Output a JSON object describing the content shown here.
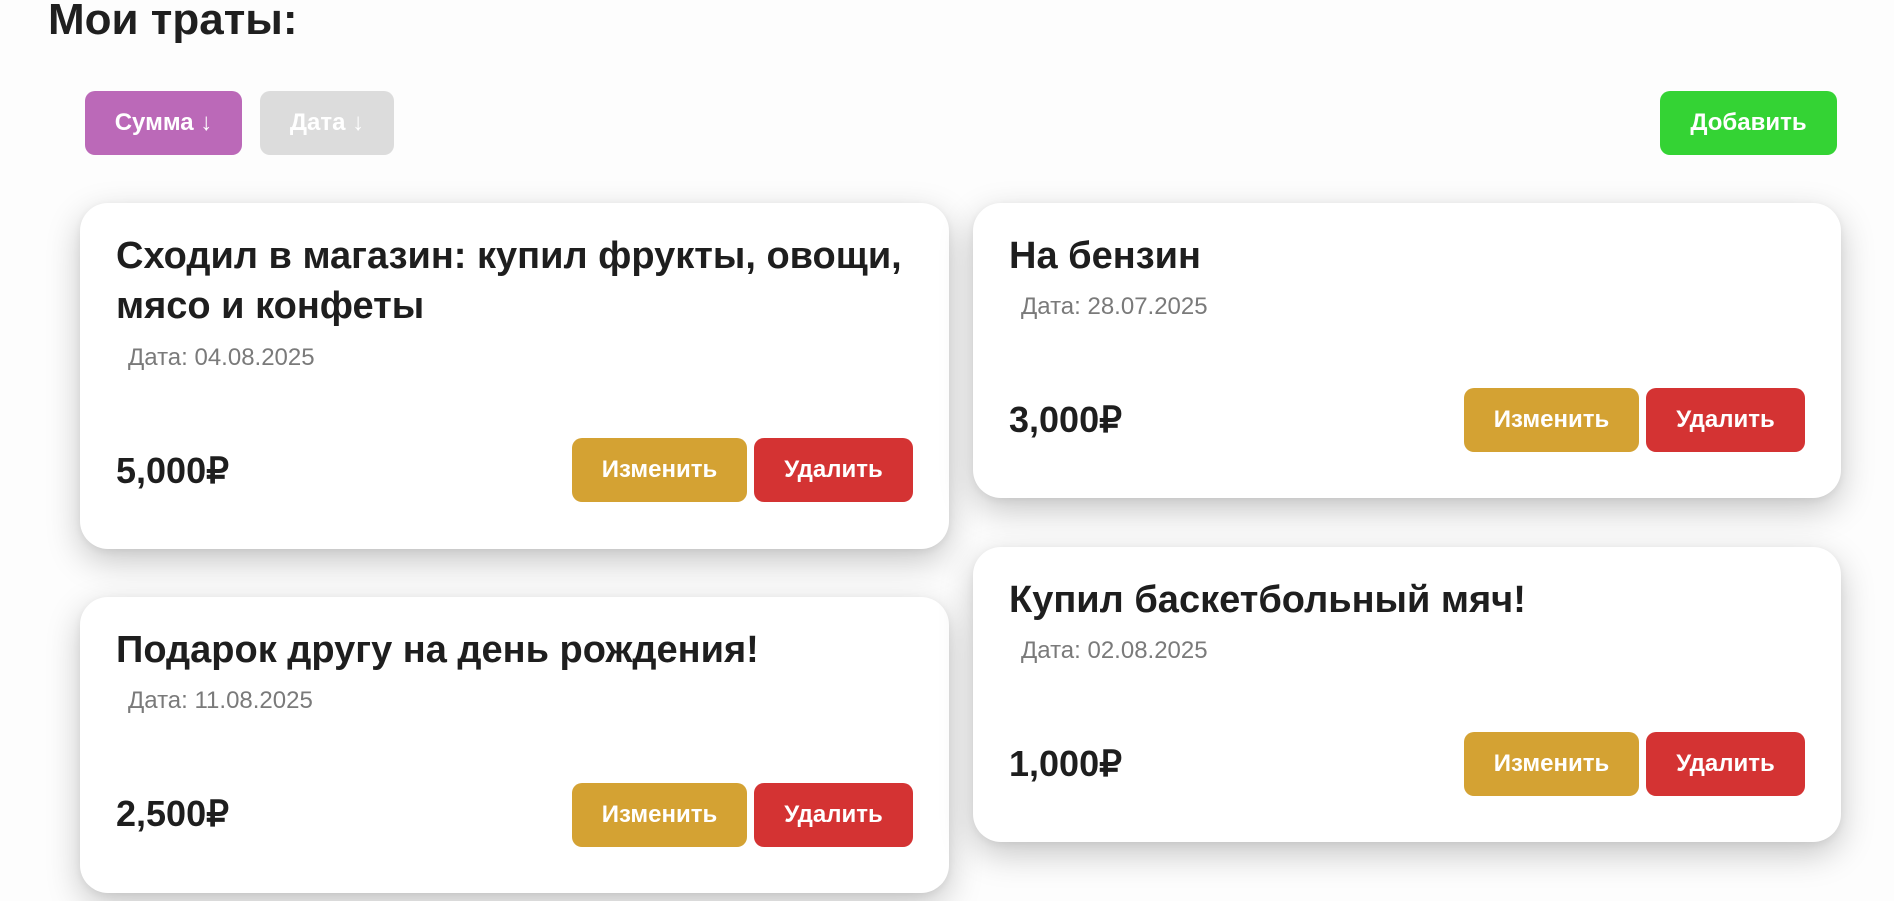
{
  "page": {
    "title": "Мои траты:"
  },
  "toolbar": {
    "sort_amount_label": "Сумма ↓",
    "sort_date_label": "Дата ↓",
    "add_label": "Добавить"
  },
  "colors": {
    "sort_active": "#bb69b8",
    "sort_inactive": "#dcdcdc",
    "add": "#34d334",
    "edit": "#d4a233",
    "delete": "#d43333"
  },
  "expenses": [
    {
      "title": "Сходил в магазин: купил фрукты, овощи, мясо и конфеты",
      "date": "Дата: 04.08.2025",
      "amount": "5,000₽",
      "edit_label": "Изменить",
      "delete_label": "Удалить"
    },
    {
      "title": "На бензин",
      "date": "Дата: 28.07.2025",
      "amount": "3,000₽",
      "edit_label": "Изменить",
      "delete_label": "Удалить"
    },
    {
      "title": "Подарок другу на день рождения!",
      "date": "Дата: 11.08.2025",
      "amount": "2,500₽",
      "edit_label": "Изменить",
      "delete_label": "Удалить"
    },
    {
      "title": "Купил баскетбольный мяч!",
      "date": "Дата: 02.08.2025",
      "amount": "1,000₽",
      "edit_label": "Изменить",
      "delete_label": "Удалить"
    }
  ]
}
